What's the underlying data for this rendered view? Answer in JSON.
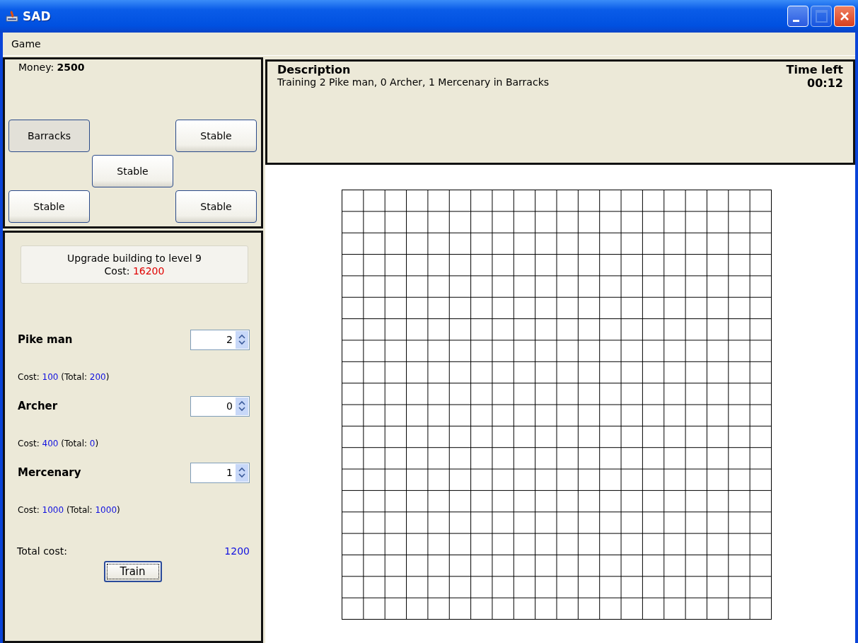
{
  "window": {
    "title": "SAD"
  },
  "menu": [
    "Game"
  ],
  "money": "Money: **2500**",
  "buildings": [
    {
      "label": "Barracks",
      "selected": true
    },
    {
      "label": "Stable",
      "selected": false
    },
    {
      "label": "Stable",
      "selected": false
    },
    {
      "label": "Stable",
      "selected": false
    },
    {
      "label": "Stable",
      "selected": false
    }
  ],
  "upgrade": {
    "text": "Upgrade building to level 9",
    "cost_label": "Cost:",
    "cost": "16200"
  },
  "units": [
    {
      "name": "Pike man",
      "count": "2",
      "cost_label": "Cost:",
      "cost": "100",
      "total_label": "(Total:",
      "total": "200",
      "close": ")"
    },
    {
      "name": "Archer",
      "count": "0",
      "cost_label": "Cost:",
      "cost": "400",
      "total_label": "(Total:",
      "total": "0",
      "close": ")"
    },
    {
      "name": "Mercenary",
      "count": "1",
      "cost_label": "Cost:",
      "cost": "1000",
      "total_label": "(Total:",
      "total": "1000",
      "close": ")"
    }
  ],
  "total": {
    "label": "Total cost:",
    "value": "1200"
  },
  "train_button": "Train",
  "description": {
    "heading": "Description",
    "text": "Training 2 Pike man, 0 Archer, 1 Mercenary in Barracks",
    "time_label": "Time left",
    "time": "00:12"
  }
}
